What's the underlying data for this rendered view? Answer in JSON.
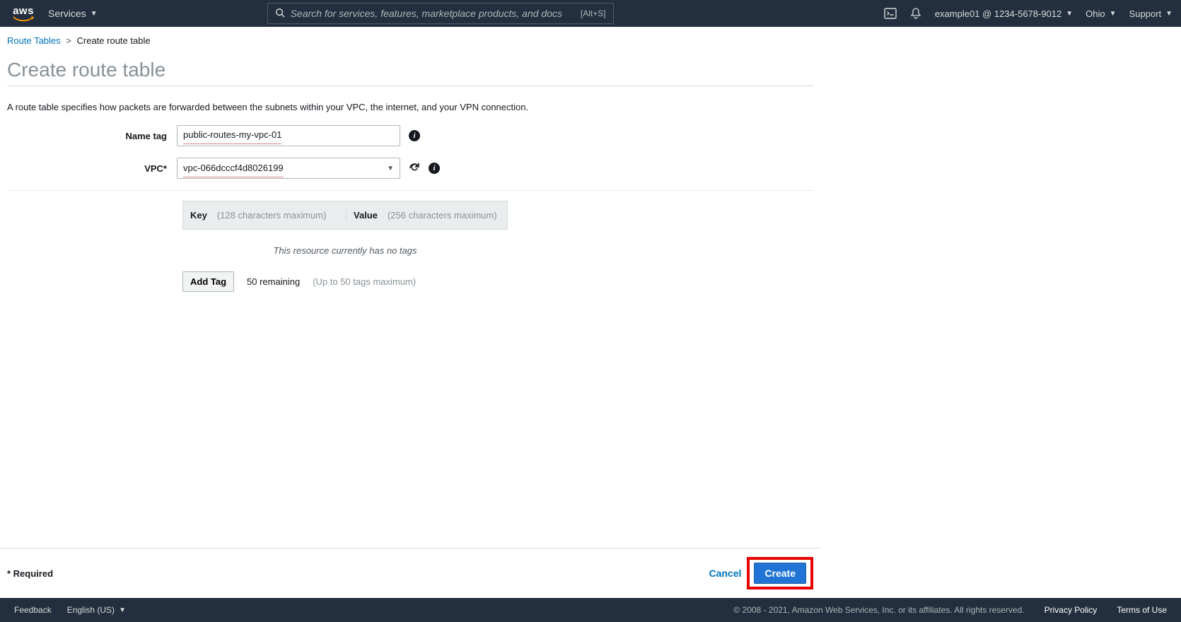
{
  "nav": {
    "services_label": "Services",
    "search_placeholder": "Search for services, features, marketplace products, and docs",
    "search_kbd": "[Alt+S]",
    "account_label": "example01 @ 1234-5678-9012",
    "region_label": "Ohio",
    "support_label": "Support"
  },
  "breadcrumbs": {
    "root_label": "Route Tables",
    "current_label": "Create route table"
  },
  "page": {
    "title": "Create route table",
    "description": "A route table specifies how packets are forwarded between the subnets within your VPC, the internet, and your VPN connection."
  },
  "form": {
    "name_label": "Name tag",
    "name_value": "public-routes-my-vpc-01",
    "vpc_label": "VPC*",
    "vpc_value": "vpc-066dcccf4d8026199"
  },
  "tags": {
    "key_label": "Key",
    "key_hint": "(128 characters maximum)",
    "value_label": "Value",
    "value_hint": "(256 characters maximum)",
    "empty_msg": "This resource currently has no tags",
    "add_btn": "Add Tag",
    "remaining": "50 remaining",
    "max_hint": "(Up to 50 tags maximum)"
  },
  "actions": {
    "required_label": "* Required",
    "cancel_label": "Cancel",
    "create_label": "Create"
  },
  "footer": {
    "feedback": "Feedback",
    "language": "English (US)",
    "copyright": "© 2008 - 2021, Amazon Web Services, Inc. or its affiliates. All rights reserved.",
    "privacy": "Privacy Policy",
    "terms": "Terms of Use"
  }
}
